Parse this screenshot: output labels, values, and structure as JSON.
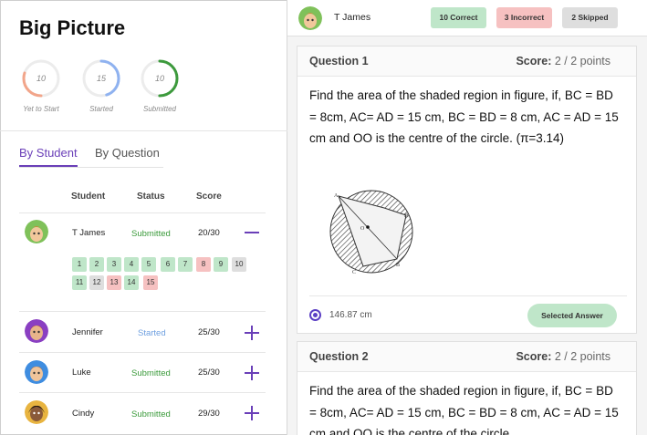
{
  "app": {
    "title": "Big Picture"
  },
  "summary": [
    {
      "count": "10",
      "caption": "Yet to Start",
      "color": "#f2a58a",
      "fraction": 0.3
    },
    {
      "count": "15",
      "caption": "Started",
      "color": "#8fb2f0",
      "fraction": 0.45
    },
    {
      "count": "10",
      "caption": "Submitted",
      "color": "#3d9a3d",
      "fraction": 0.5
    }
  ],
  "tabs": [
    {
      "label": "By Student",
      "active": true
    },
    {
      "label": "By Question",
      "active": false
    }
  ],
  "table": {
    "headers": {
      "student": "Student",
      "status": "Status",
      "score": "Score"
    },
    "rows": [
      {
        "name": "T James",
        "status": "Submitted",
        "score": "20/30",
        "expanded": true
      },
      {
        "name": "Jennifer",
        "status": "Started",
        "score": "25/30",
        "expanded": false
      },
      {
        "name": "Luke",
        "status": "Submitted",
        "score": "25/30",
        "expanded": false
      },
      {
        "name": "Cindy",
        "status": "Submitted",
        "score": "29/30",
        "expanded": false
      }
    ],
    "question_chips": [
      {
        "n": "1",
        "result": "correct"
      },
      {
        "n": "2",
        "result": "correct"
      },
      {
        "n": "3",
        "result": "correct"
      },
      {
        "n": "4",
        "result": "correct"
      },
      {
        "n": "5",
        "result": "correct"
      },
      {
        "n": "6",
        "result": "correct"
      },
      {
        "n": "7",
        "result": "correct"
      },
      {
        "n": "8",
        "result": "incorrect"
      },
      {
        "n": "9",
        "result": "correct"
      },
      {
        "n": "10",
        "result": "skipped"
      },
      {
        "n": "11",
        "result": "correct"
      },
      {
        "n": "12",
        "result": "skipped"
      },
      {
        "n": "13",
        "result": "incorrect"
      },
      {
        "n": "14",
        "result": "correct"
      },
      {
        "n": "15",
        "result": "incorrect"
      }
    ]
  },
  "detail": {
    "student_name": "T James",
    "badges": {
      "correct": "10 Correct",
      "incorrect": "3 Incorrect",
      "skipped": "2 Skipped"
    },
    "questions": [
      {
        "title": "Question 1",
        "score_label": "Score:",
        "score_value": "2 / 2 points",
        "text": "Find the area of the shaded region in figure, if, BC = BD = 8cm, AC= AD = 15 cm, BC = BD = 8 cm, AC = AD = 15 cm and OO is the centre of the circle. (π=3.14)",
        "answer": "146.87 cm",
        "answer_button": "Selected Answer"
      },
      {
        "title": "Question 2",
        "score_label": "Score:",
        "score_value": "2 / 2 points",
        "text": "Find the area of the shaded region in figure, if, BC = BD = 8cm, AC= AD = 15 cm, BC = BD = 8 cm, AC = AD = 15 cm and OO is the centre of the circle."
      }
    ],
    "figure_labels": {
      "a": "A",
      "b": "B",
      "c": "C",
      "d": "D",
      "o": "O"
    }
  },
  "colors": {
    "accent": "#6a3fb8",
    "correct": "#bfe6c9",
    "incorrect": "#f6c1c1",
    "skipped": "#dedede"
  }
}
